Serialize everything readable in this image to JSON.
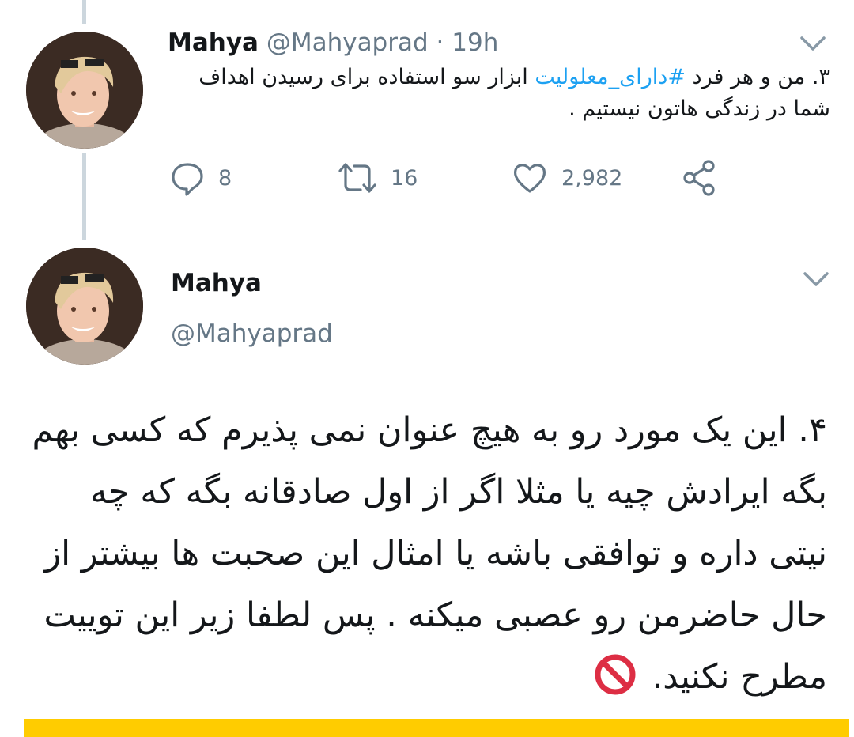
{
  "tweet1": {
    "name": "Mahya",
    "handle": "@Mahyaprad",
    "dot": "·",
    "time": "19h",
    "text_before": "۳. من و هر فرد ",
    "hashtag": "#دارای_معلولیت",
    "text_after": " ابزار سو استفاده برای رسیدن اهداف شما در زندگی هاتون نیستیم .",
    "actions": {
      "replies": "8",
      "retweets": "16",
      "likes": "2,982"
    }
  },
  "tweet2": {
    "name": "Mahya",
    "handle": "@Mahyaprad",
    "text": "۴. این یک مورد رو به هیچ عنوان نمی پذیرم که کسی بهم بگه ایرادش چیه یا مثلا اگر از اول صادقانه بگه که چه نیتی داره و توافقی باشه یا امثال این صحبت ها بیشتر از حال حاضرمن رو عصبی میکنه . پس لطفا زیر این توییت مطرح نکنید."
  },
  "colors": {
    "accent": "#1da1f2",
    "muted": "#657786",
    "thread_line": "#ccd6dd",
    "no_entry": "#dd2e44",
    "bottom_bar": "#ffcc00"
  },
  "icons": [
    "reply-icon",
    "retweet-icon",
    "like-icon",
    "share-icon",
    "chevron-down-icon",
    "no-entry-emoji"
  ]
}
